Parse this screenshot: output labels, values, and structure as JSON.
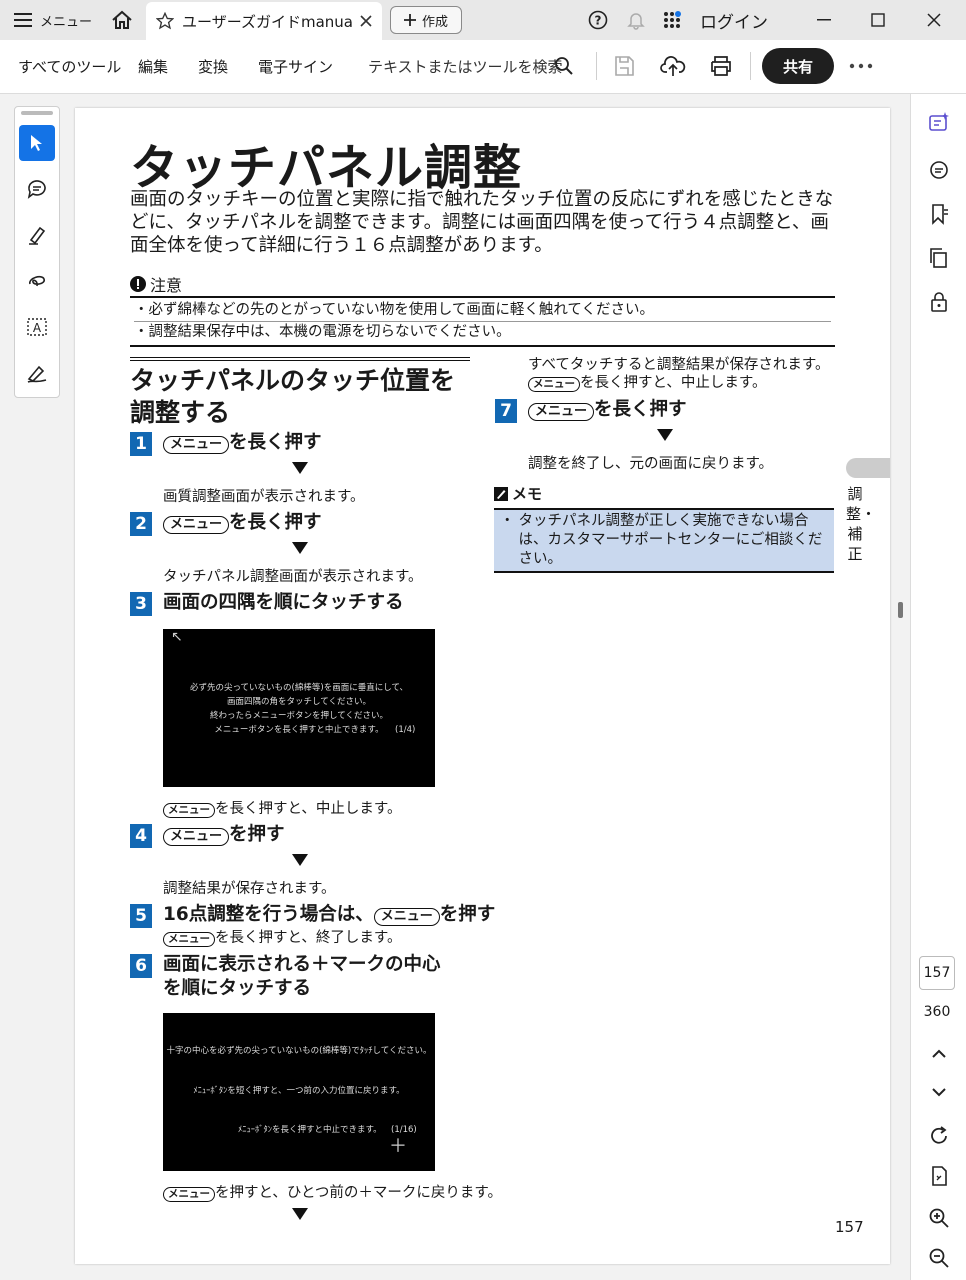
{
  "titlebar": {
    "menu_label": "メニュー",
    "tab_title": "ユーザーズガイドmanua...",
    "create_label": "作成",
    "login_label": "ログイン"
  },
  "toolbar": {
    "all_tools": "すべてのツール",
    "edit": "編集",
    "convert": "変換",
    "esign": "電子サイン",
    "search_placeholder": "テキストまたはツールを検索",
    "share_label": "共有"
  },
  "nav": {
    "current_page": "157",
    "total_pages": "360"
  },
  "doc": {
    "title": "タッチパネル調整",
    "intro": "画面のタッチキーの位置と実際に指で触れたタッチ位置の反応にずれを感じたときなどに、タッチパネルを調整できます。調整には画面四隅を使って行う４点調整と、画面全体を使って詳細に行う１６点調整があります。",
    "caution_title": "注意",
    "caution_items": [
      "必ず綿棒などの先のとがっていない物を使用して画面に軽く触れてください。",
      "調整結果保存中は、本機の電源を切らないでください。"
    ],
    "section_title": "タッチパネルのタッチ位置を調整する",
    "key_menu": "メニュー",
    "steps": [
      {
        "num": "1",
        "text": "を長く押す",
        "desc": "画質調整画面が表示されます。"
      },
      {
        "num": "2",
        "text": "を長く押す",
        "desc": "タッチパネル調整画面が表示されます。"
      },
      {
        "num": "3",
        "text": "画面の四隅を順にタッチする",
        "desc": "を長く押すと、中止します。"
      },
      {
        "num": "4",
        "text": "を押す",
        "desc": "調整結果が保存されます。"
      },
      {
        "num": "5",
        "text_pre": "16点調整を行う場合は、",
        "text": "を押す",
        "desc": "を長く押すと、終了します。"
      },
      {
        "num": "6",
        "text1": "画面に表示される＋マークの中心",
        "text2": "を順にタッチする",
        "desc": "を押すと、ひとつ前の＋マークに戻ります。"
      },
      {
        "num": "7",
        "text": "を長く押す",
        "desc": "調整を終了し、元の画面に戻ります。"
      }
    ],
    "col2_top1": "すべてタッチすると調整結果が保存されます。",
    "col2_top2": "を長く押すと、中止します。",
    "screen1": {
      "arrow": "↖",
      "lines": [
        "必ず先の尖っていないもの(綿棒等)を画面に垂直にして、",
        "画面四隅の角をタッチしてください。",
        "終わったらメニューボタンを押してください。",
        "メニューボタンを長く押すと中止できます。"
      ],
      "counter": "(1/4)"
    },
    "screen2": {
      "line1": "十字の中心を必ず先の尖っていないもの(綿棒等)でﾀｯﾁしてください。",
      "line2": "ﾒﾆｭｰﾎﾞﾀﾝを短く押すと、一つ前の入力位置に戻ります。",
      "line3": "ﾒﾆｭｰﾎﾞﾀﾝを長く押すと中止できます。",
      "counter": "(1/16)",
      "plus": "＋"
    },
    "memo_title": "メモ",
    "memo_item": "タッチパネル調整が正しく実施できない場合は、カスタマーサポートセンターにご相談ください。",
    "side_label": "調整・補正",
    "page_number": "157"
  }
}
